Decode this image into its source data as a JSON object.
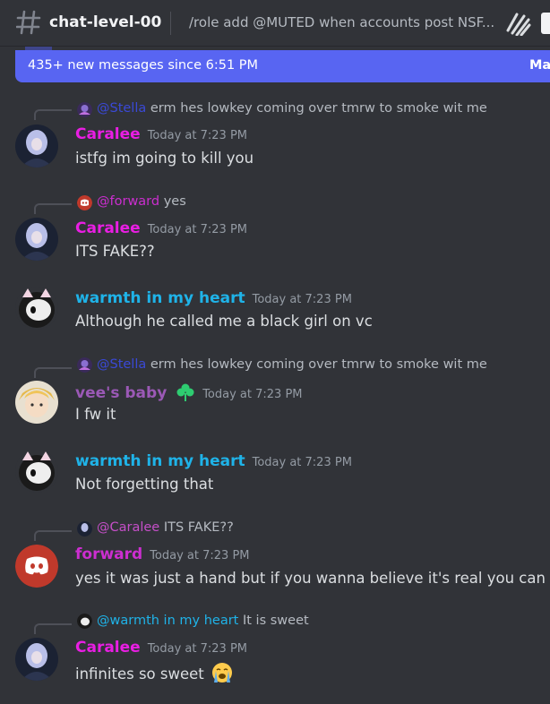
{
  "header": {
    "channel_icon": "hashtag-icon",
    "channel_name": "chat-level-00",
    "topic": "/role add @MUTED when accounts post NSF...",
    "threads_icon": "threads-icon"
  },
  "new_messages_bar": {
    "text": "435+ new messages since 6:51 PM",
    "action_label": "Ma"
  },
  "colors": {
    "caralee": "#e91ee3",
    "warmth": "#1fb3e8",
    "vee": "#9b59b6",
    "forward": "#cc2ed0",
    "mention_stella": "#3a49d6",
    "accent": "#5865f2"
  },
  "messages": [
    {
      "reply_mention": "@Stella",
      "reply_text": "erm hes lowkey coming over tmrw to smoke wit me",
      "author": "Caralee",
      "time": "Today at 7:23 PM",
      "content": "istfg im going to kill you"
    },
    {
      "reply_mention": "@forward",
      "reply_text": "yes",
      "author": "Caralee",
      "time": "Today at 7:23 PM",
      "content": "ITS FAKE??"
    },
    {
      "author": "warmth in my heart",
      "time": "Today at 7:23 PM",
      "content": "Although he called me a black girl on vc"
    },
    {
      "reply_mention": "@Stella",
      "reply_text": "erm hes lowkey coming over tmrw to smoke wit me",
      "author": "vee's baby",
      "author_badge": "clover-emoji-icon",
      "time": "Today at 7:23 PM",
      "content": "I fw it"
    },
    {
      "author": "warmth in my heart",
      "time": "Today at 7:23 PM",
      "content": "Not forgetting that"
    },
    {
      "reply_mention": "@Caralee",
      "reply_text": "ITS FAKE??",
      "author": "forward",
      "time": "Today at 7:23 PM",
      "content": "yes it was just a hand but if you wanna believe it's real you can"
    },
    {
      "reply_mention": "@warmth in my heart",
      "reply_text": "It is sweet",
      "author": "Caralee",
      "time": "Today at 7:23 PM",
      "content": "infinites so sweet",
      "content_emoji": "loudly-crying-emoji-icon"
    }
  ]
}
